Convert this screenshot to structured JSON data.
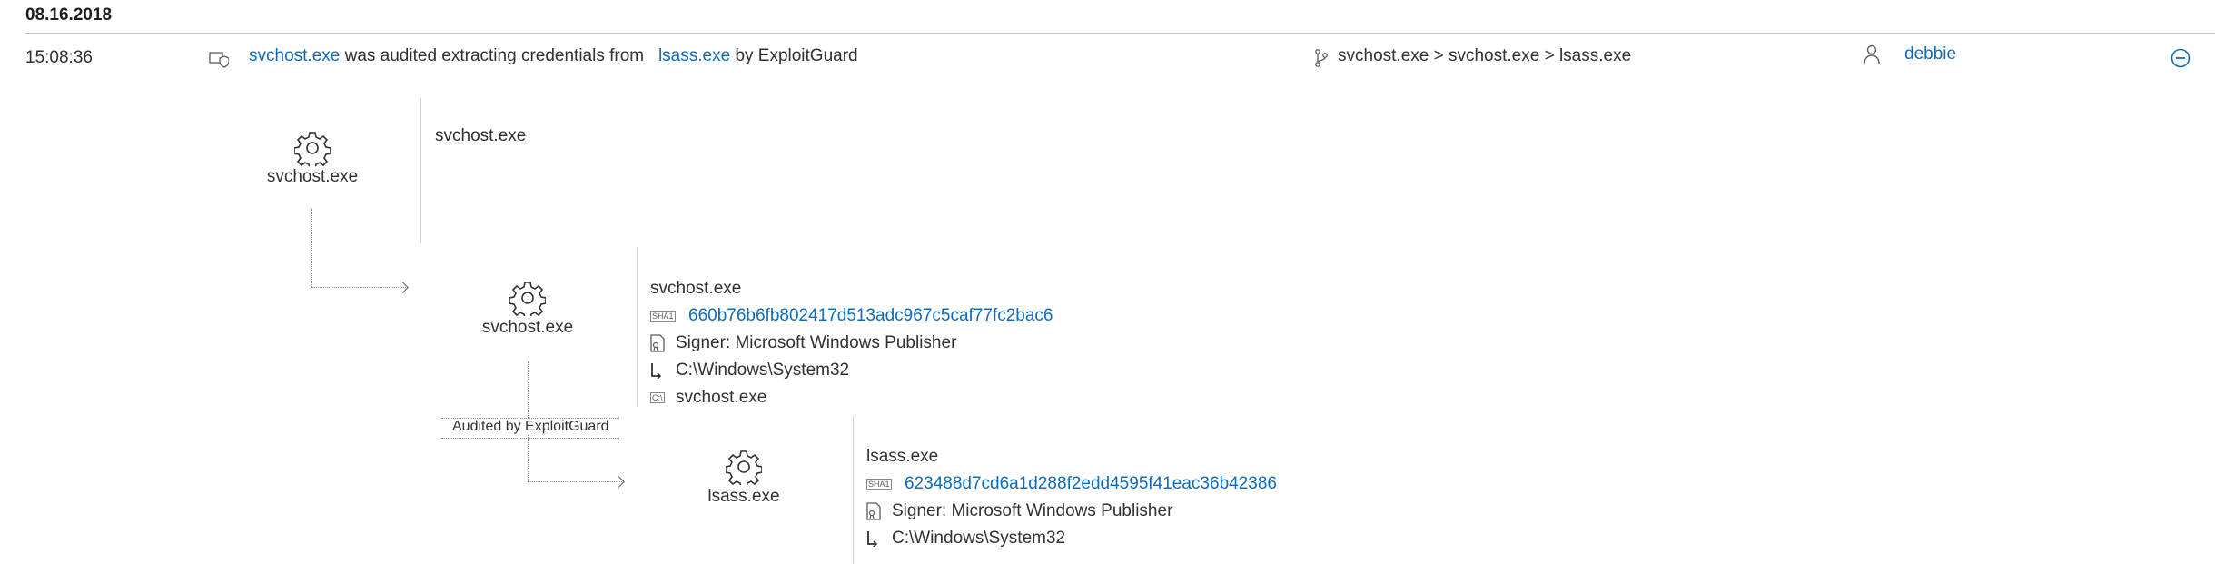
{
  "date": "08.16.2018",
  "event": {
    "time": "15:08:36",
    "actor": "svchost.exe",
    "action_text": "was audited extracting credentials from",
    "target": "lsass.exe",
    "by_text": "by ExploitGuard",
    "process_chain": "svchost.exe > svchost.exe > lsass.exe",
    "user": "debbie"
  },
  "tree": {
    "node1": {
      "label": "svchost.exe",
      "detail_title": "svchost.exe"
    },
    "node2": {
      "label": "svchost.exe",
      "detail_title": "svchost.exe",
      "sha1_badge": "SHA1",
      "sha1": "660b76b6fb802417d513adc967c5caf77fc2bac6",
      "signer": "Signer: Microsoft Windows Publisher",
      "path": "C:\\Windows\\System32",
      "cmd": "svchost.exe",
      "cmd_badge": "C:\\"
    },
    "audit_label": "Audited by ExploitGuard",
    "node3": {
      "label": "lsass.exe",
      "detail_title": "lsass.exe",
      "sha1_badge": "SHA1",
      "sha1": "623488d7cd6a1d288f2edd4595f41eac36b42386",
      "signer": "Signer: Microsoft Windows Publisher",
      "path": "C:\\Windows\\System32"
    }
  },
  "colors": {
    "link": "#0f6cbd",
    "text": "#323130",
    "rule": "#c8c6c4"
  }
}
